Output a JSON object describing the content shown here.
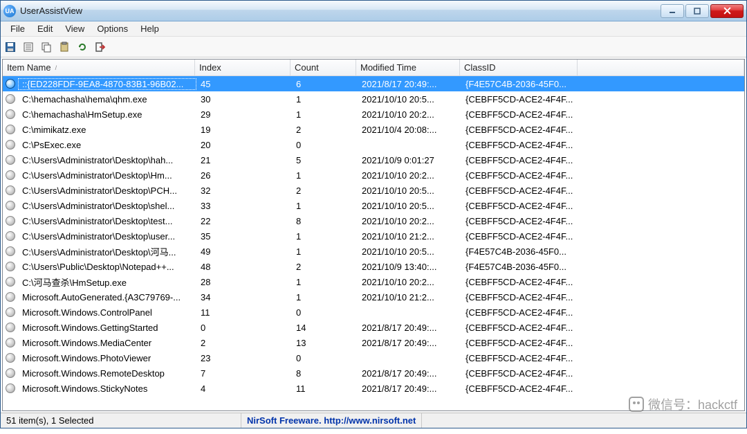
{
  "window": {
    "title": "UserAssistView",
    "icon_label": "UA"
  },
  "menu": {
    "file": "File",
    "edit": "Edit",
    "view": "View",
    "options": "Options",
    "help": "Help"
  },
  "columns": {
    "name": "Item Name",
    "index": "Index",
    "count": "Count",
    "modified": "Modified Time",
    "classid": "ClassID"
  },
  "rows": [
    {
      "selected": true,
      "name": "::{ED228FDF-9EA8-4870-83B1-96B02...",
      "index": "45",
      "count": "6",
      "time": "2021/8/17 20:49:...",
      "classid": "{F4E57C4B-2036-45F0..."
    },
    {
      "selected": false,
      "name": "C:\\hemachasha\\hema\\qhm.exe",
      "index": "30",
      "count": "1",
      "time": "2021/10/10 20:5...",
      "classid": "{CEBFF5CD-ACE2-4F4F..."
    },
    {
      "selected": false,
      "name": "C:\\hemachasha\\HmSetup.exe",
      "index": "29",
      "count": "1",
      "time": "2021/10/10 20:2...",
      "classid": "{CEBFF5CD-ACE2-4F4F..."
    },
    {
      "selected": false,
      "name": "C:\\mimikatz.exe",
      "index": "19",
      "count": "2",
      "time": "2021/10/4 20:08:...",
      "classid": "{CEBFF5CD-ACE2-4F4F..."
    },
    {
      "selected": false,
      "name": "C:\\PsExec.exe",
      "index": "20",
      "count": "0",
      "time": "",
      "classid": "{CEBFF5CD-ACE2-4F4F..."
    },
    {
      "selected": false,
      "name": "C:\\Users\\Administrator\\Desktop\\hah...",
      "index": "21",
      "count": "5",
      "time": "2021/10/9 0:01:27",
      "classid": "{CEBFF5CD-ACE2-4F4F..."
    },
    {
      "selected": false,
      "name": "C:\\Users\\Administrator\\Desktop\\Hm...",
      "index": "26",
      "count": "1",
      "time": "2021/10/10 20:2...",
      "classid": "{CEBFF5CD-ACE2-4F4F..."
    },
    {
      "selected": false,
      "name": "C:\\Users\\Administrator\\Desktop\\PCH...",
      "index": "32",
      "count": "2",
      "time": "2021/10/10 20:5...",
      "classid": "{CEBFF5CD-ACE2-4F4F..."
    },
    {
      "selected": false,
      "name": "C:\\Users\\Administrator\\Desktop\\shel...",
      "index": "33",
      "count": "1",
      "time": "2021/10/10 20:5...",
      "classid": "{CEBFF5CD-ACE2-4F4F..."
    },
    {
      "selected": false,
      "name": "C:\\Users\\Administrator\\Desktop\\test...",
      "index": "22",
      "count": "8",
      "time": "2021/10/10 20:2...",
      "classid": "{CEBFF5CD-ACE2-4F4F..."
    },
    {
      "selected": false,
      "name": "C:\\Users\\Administrator\\Desktop\\user...",
      "index": "35",
      "count": "1",
      "time": "2021/10/10 21:2...",
      "classid": "{CEBFF5CD-ACE2-4F4F..."
    },
    {
      "selected": false,
      "name": "C:\\Users\\Administrator\\Desktop\\河马...",
      "index": "49",
      "count": "1",
      "time": "2021/10/10 20:5...",
      "classid": "{F4E57C4B-2036-45F0..."
    },
    {
      "selected": false,
      "name": "C:\\Users\\Public\\Desktop\\Notepad++...",
      "index": "48",
      "count": "2",
      "time": "2021/10/9 13:40:...",
      "classid": "{F4E57C4B-2036-45F0..."
    },
    {
      "selected": false,
      "name": "C:\\河马查杀\\HmSetup.exe",
      "index": "28",
      "count": "1",
      "time": "2021/10/10 20:2...",
      "classid": "{CEBFF5CD-ACE2-4F4F..."
    },
    {
      "selected": false,
      "name": "Microsoft.AutoGenerated.{A3C79769-...",
      "index": "34",
      "count": "1",
      "time": "2021/10/10 21:2...",
      "classid": "{CEBFF5CD-ACE2-4F4F..."
    },
    {
      "selected": false,
      "name": "Microsoft.Windows.ControlPanel",
      "index": "11",
      "count": "0",
      "time": "",
      "classid": "{CEBFF5CD-ACE2-4F4F..."
    },
    {
      "selected": false,
      "name": "Microsoft.Windows.GettingStarted",
      "index": "0",
      "count": "14",
      "time": "2021/8/17 20:49:...",
      "classid": "{CEBFF5CD-ACE2-4F4F..."
    },
    {
      "selected": false,
      "name": "Microsoft.Windows.MediaCenter",
      "index": "2",
      "count": "13",
      "time": "2021/8/17 20:49:...",
      "classid": "{CEBFF5CD-ACE2-4F4F..."
    },
    {
      "selected": false,
      "name": "Microsoft.Windows.PhotoViewer",
      "index": "23",
      "count": "0",
      "time": "",
      "classid": "{CEBFF5CD-ACE2-4F4F..."
    },
    {
      "selected": false,
      "name": "Microsoft.Windows.RemoteDesktop",
      "index": "7",
      "count": "8",
      "time": "2021/8/17 20:49:...",
      "classid": "{CEBFF5CD-ACE2-4F4F..."
    },
    {
      "selected": false,
      "name": "Microsoft.Windows.StickyNotes",
      "index": "4",
      "count": "11",
      "time": "2021/8/17 20:49:...",
      "classid": "{CEBFF5CD-ACE2-4F4F..."
    }
  ],
  "status": {
    "left": "51 item(s), 1 Selected",
    "right": "NirSoft Freeware.  http://www.nirsoft.net"
  },
  "watermark": "微信号：hackctf"
}
